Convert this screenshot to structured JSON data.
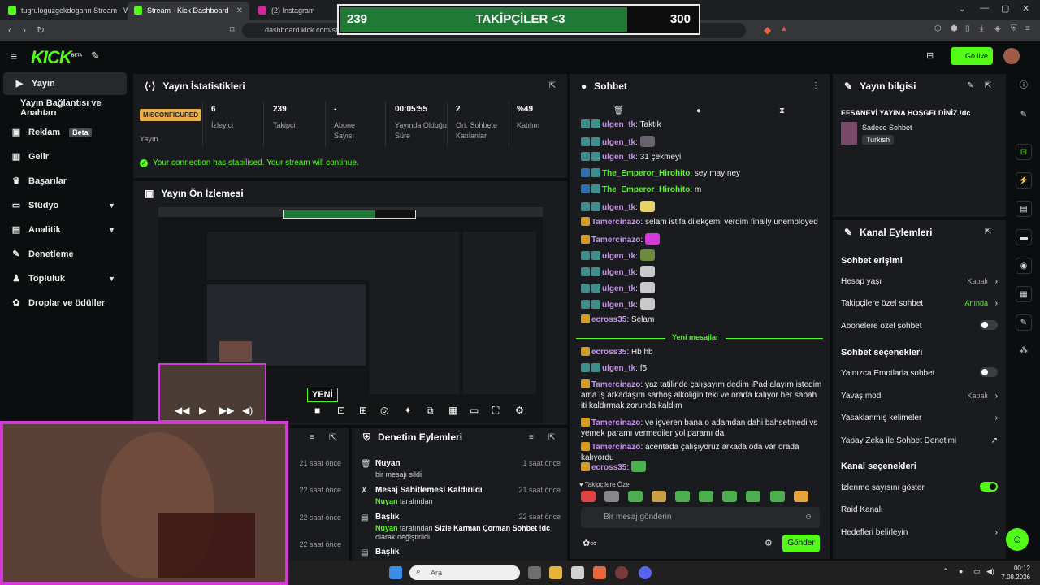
{
  "browser": {
    "tabs": [
      {
        "title": "tugruloguzgokdogann Stream - Wat",
        "color": "#53fc18"
      },
      {
        "title": "Stream - Kick Dashboard",
        "color": "#53fc18"
      },
      {
        "title": "(2) Instagram",
        "color": "#d6249f"
      }
    ],
    "url": "dashboard.kick.com/st"
  },
  "overlay": {
    "left": "239",
    "title": "TAKİPÇİLER <3",
    "right": "300",
    "progress": 0.797
  },
  "header": {
    "logo": "KICK",
    "logo_beta": "BETA",
    "golive": "Go live"
  },
  "sidebar": {
    "items": [
      {
        "label": "Yayın",
        "icon": "video-icon"
      },
      {
        "label": "Yayın Bağlantısı ve Anahtarı",
        "icon": ""
      },
      {
        "label": "Reklam",
        "icon": "ad-icon",
        "badge": "Beta"
      },
      {
        "label": "Gelir",
        "icon": "chart-icon"
      },
      {
        "label": "Başarılar",
        "icon": "trophy-icon"
      },
      {
        "label": "Stüdyo",
        "icon": "studio-icon"
      },
      {
        "label": "Analitik",
        "icon": "analytics-icon"
      },
      {
        "label": "Denetleme",
        "icon": "wrench-icon"
      },
      {
        "label": "Topluluk",
        "icon": "community-icon"
      },
      {
        "label": "Droplar ve ödüller",
        "icon": "gift-icon"
      }
    ]
  },
  "stats": {
    "title": "Yayın İstatistikleri",
    "status_badge": "MISCONFIGURED",
    "status_label": "Yayın",
    "items": [
      {
        "value": "6",
        "label": "İzleyici"
      },
      {
        "value": "239",
        "label": "Takipçi"
      },
      {
        "value": "-",
        "label": "Abone Sayısı"
      },
      {
        "value": "00:05:55",
        "label": "Yayında Olduğu Süre"
      },
      {
        "value": "2",
        "label": "Ort. Sohbete Katılanlar"
      },
      {
        "value": "%49",
        "label": "Katılım"
      }
    ],
    "connection": "Your connection has stabilised. Your stream will continue."
  },
  "preview": {
    "title": "Yayın Ön İzlemesi",
    "yeni": "YENİ"
  },
  "log": {
    "times": [
      "21 saat önce",
      "22 saat önce",
      "22 saat önce",
      "22 saat önce"
    ]
  },
  "moderation": {
    "title": "Denetim Eylemleri",
    "entries": [
      {
        "title": "Nuyan",
        "sub": "bir mesajı sildi",
        "time": "1 saat önce"
      },
      {
        "title": "Mesaj Sabitlemesi Kaldırıldı",
        "user": "Nuyan",
        "sub": "tarafından",
        "time": "21 saat önce"
      },
      {
        "title": "Başlık",
        "user": "Nuyan",
        "sub": "tarafından",
        "bold": "Sizle Karman Çorman Sohbet !dc",
        "sub2": "olarak değiştirildi",
        "time": "22 saat önce"
      },
      {
        "title": "Başlık",
        "time": ""
      }
    ]
  },
  "chat": {
    "title": "Sohbet",
    "messages": [
      {
        "user": "ulgen_tk",
        "color": "#c792ea",
        "text": "Taktık"
      },
      {
        "user": "ulgen_tk",
        "color": "#c792ea",
        "text": "",
        "emote": "#6b6270"
      },
      {
        "user": "ulgen_tk",
        "color": "#c792ea",
        "text": "31 çekmeyi"
      },
      {
        "user": "The_Emperor_Hirohito",
        "color": "#53fc18",
        "text": "sey may ney"
      },
      {
        "user": "The_Emperor_Hirohito",
        "color": "#53fc18",
        "text": "m"
      },
      {
        "user": "ulgen_tk",
        "color": "#c792ea",
        "text": "",
        "emote": "#e8d36a"
      },
      {
        "user": "Tamercinazo",
        "color": "#c792ea",
        "text": "selam istifa dilekçemi verdim finally unemployed"
      },
      {
        "user": "Tamercinazo",
        "color": "#c792ea",
        "text": "",
        "emote": "#d33ad8"
      },
      {
        "user": "ulgen_tk",
        "color": "#c792ea",
        "text": "",
        "emote": "#6e8b3d"
      },
      {
        "user": "ulgen_tk",
        "color": "#c792ea",
        "text": "",
        "emote": "#c9c9c9"
      },
      {
        "user": "ulgen_tk",
        "color": "#c792ea",
        "text": "",
        "emote": "#c9c9c9"
      },
      {
        "user": "ulgen_tk",
        "color": "#c792ea",
        "text": "",
        "emote": "#c9c9c9"
      },
      {
        "user": "ecross35",
        "color": "#c792ea",
        "text": "Selam"
      }
    ],
    "new_messages": "Yeni mesajlar",
    "messages2": [
      {
        "user": "ecross35",
        "text": "Hb hb"
      },
      {
        "user": "ulgen_tk",
        "text": "f5"
      },
      {
        "user": "Tamercinazo",
        "text": "yaz tatilinde çalışayım dedim iPad alayım istedim ama iş arkadaşım sarhoş alkoliğin teki ve orada kalıyor her sabah iti kaldırmak zorunda kaldım"
      },
      {
        "user": "Tamercinazo",
        "text": "ve işveren bana o adamdan dahi bahsetmedi vs yemek paramı vermediler yol paramı da"
      },
      {
        "user": "Tamercinazo",
        "text": "acentada çalışıyoruz arkada oda var orada kalıyordu"
      },
      {
        "user": "ecross35",
        "text": "",
        "emote": "#4caf50"
      }
    ],
    "followers_only": "Takipçilere Özel",
    "placeholder": "Bir mesaj gönderin",
    "send": "Gönder"
  },
  "info": {
    "title": "Yayın bilgisi",
    "stream_title": "EFSANEVİ YAYINA HOŞGELDİNİZ !dc",
    "category": "Sadece Sohbet",
    "tag": "Turkish"
  },
  "channel": {
    "title": "Kanal Eylemleri",
    "chat_access": "Sohbet erişimi",
    "age": {
      "label": "Hesap yaşı",
      "value": "Kapalı"
    },
    "followers": {
      "label": "Takipçilere özel sohbet",
      "value": "Anında"
    },
    "subs": {
      "label": "Abonelere özel sohbet"
    },
    "chat_options": "Sohbet seçenekleri",
    "emotes": {
      "label": "Yalnızca Emotlarla sohbet"
    },
    "slow": {
      "label": "Yavaş mod",
      "value": "Kapalı"
    },
    "banned": {
      "label": "Yasaklanmış kelimeler"
    },
    "ai": {
      "label": "Yapay Zeka ile Sohbet Denetimi"
    },
    "channel_options": "Kanal seçenekleri",
    "viewers": {
      "label": "İzlenme sayısını göster"
    },
    "raid": {
      "label": "Raid Kanalı"
    },
    "goals": {
      "label": "Hedefleri belirleyin"
    }
  },
  "taskbar": {
    "search": "Ara",
    "time": "00:12",
    "date": "7.08.2026"
  }
}
